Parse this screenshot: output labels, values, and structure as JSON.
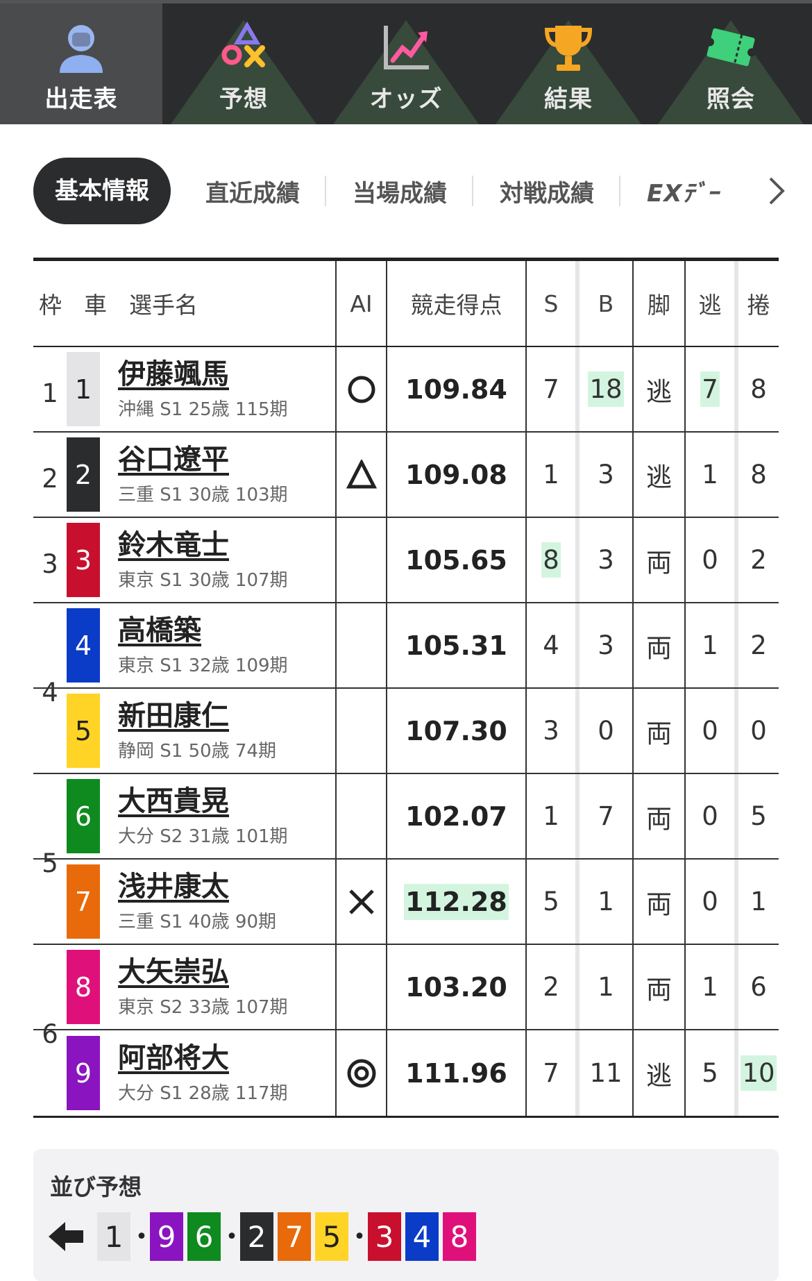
{
  "nav": [
    {
      "label": "出走表",
      "icon": "racer-icon",
      "active": true
    },
    {
      "label": "予想",
      "icon": "prediction-icon",
      "active": false
    },
    {
      "label": "オッズ",
      "icon": "odds-chart-icon",
      "active": false
    },
    {
      "label": "結果",
      "icon": "trophy-icon",
      "active": false
    },
    {
      "label": "照会",
      "icon": "ticket-icon",
      "active": false
    }
  ],
  "tabs": [
    "基本情報",
    "直近成績",
    "当場成績",
    "対戦成績",
    "EXﾃﾞｰ"
  ],
  "table": {
    "headers": {
      "waku": "枠",
      "car": "車",
      "name": "選手名",
      "ai": "AI",
      "score": "競走得点",
      "s": "S",
      "b": "B",
      "leg": "脚",
      "nige": "逃",
      "maki": "捲"
    },
    "waku_labels": [
      "1",
      "2",
      "3",
      "4",
      "5",
      "6"
    ],
    "rows": [
      {
        "car": "1",
        "name": "伊藤颯馬",
        "info": "沖縄 S1 25歳 115期",
        "ai": "circle",
        "score": "109.84",
        "s": "7",
        "b": "18",
        "leg": "逃",
        "nige": "7",
        "maki": "8"
      },
      {
        "car": "2",
        "name": "谷口遼平",
        "info": "三重 S1 30歳 103期",
        "ai": "triangle",
        "score": "109.08",
        "s": "1",
        "b": "3",
        "leg": "逃",
        "nige": "1",
        "maki": "8"
      },
      {
        "car": "3",
        "name": "鈴木竜士",
        "info": "東京 S1 30歳 107期",
        "ai": "",
        "score": "105.65",
        "s": "8",
        "b": "3",
        "leg": "両",
        "nige": "0",
        "maki": "2"
      },
      {
        "car": "4",
        "name": "高橋築",
        "info": "東京 S1 32歳 109期",
        "ai": "",
        "score": "105.31",
        "s": "4",
        "b": "3",
        "leg": "両",
        "nige": "1",
        "maki": "2"
      },
      {
        "car": "5",
        "name": "新田康仁",
        "info": "静岡 S1 50歳 74期",
        "ai": "",
        "score": "107.30",
        "s": "3",
        "b": "0",
        "leg": "両",
        "nige": "0",
        "maki": "0"
      },
      {
        "car": "6",
        "name": "大西貴晃",
        "info": "大分 S2 31歳 101期",
        "ai": "",
        "score": "102.07",
        "s": "1",
        "b": "7",
        "leg": "両",
        "nige": "0",
        "maki": "5"
      },
      {
        "car": "7",
        "name": "浅井康太",
        "info": "三重 S1 40歳 90期",
        "ai": "cross",
        "score": "112.28",
        "s": "5",
        "b": "1",
        "leg": "両",
        "nige": "0",
        "maki": "1"
      },
      {
        "car": "8",
        "name": "大矢崇弘",
        "info": "東京 S2 33歳 107期",
        "ai": "",
        "score": "103.20",
        "s": "2",
        "b": "1",
        "leg": "両",
        "nige": "1",
        "maki": "6"
      },
      {
        "car": "9",
        "name": "阿部将大",
        "info": "大分 S1 28歳 117期",
        "ai": "double-circle",
        "score": "111.96",
        "s": "7",
        "b": "11",
        "leg": "逃",
        "nige": "5",
        "maki": "10"
      }
    ]
  },
  "car_colors": {
    "1": {
      "bg": "#e4e4e6",
      "fg": "#222222"
    },
    "2": {
      "bg": "#2b2c2e",
      "fg": "#ffffff"
    },
    "3": {
      "bg": "#c8102e",
      "fg": "#ffffff"
    },
    "4": {
      "bg": "#0a3cc8",
      "fg": "#ffffff"
    },
    "5": {
      "bg": "#ffd426",
      "fg": "#222222"
    },
    "6": {
      "bg": "#0e8a1e",
      "fg": "#ffffff"
    },
    "7": {
      "bg": "#e86a0a",
      "fg": "#ffffff"
    },
    "8": {
      "bg": "#e0107a",
      "fg": "#ffffff"
    },
    "9": {
      "bg": "#8a14c0",
      "fg": "#ffffff"
    }
  },
  "highlight_color": "#d3f5e0",
  "narabi": {
    "title": "並び予想",
    "lines": [
      [
        "1"
      ],
      [
        "9",
        "6"
      ],
      [
        "2",
        "7",
        "5"
      ],
      [
        "3",
        "4",
        "8"
      ]
    ]
  }
}
